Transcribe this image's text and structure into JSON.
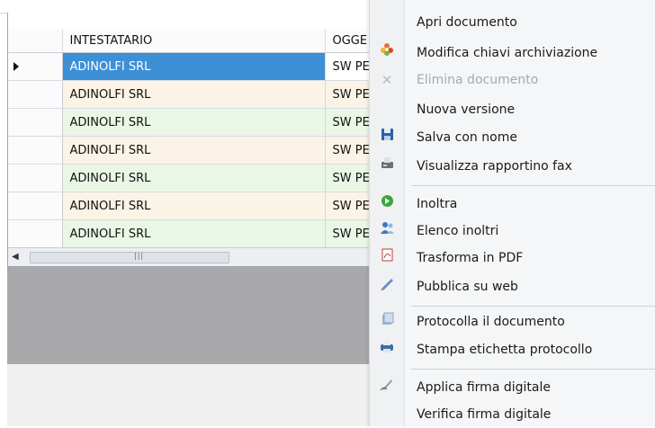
{
  "grid": {
    "columns": [
      "INTESTATARIO",
      "OGGE"
    ],
    "rows": [
      {
        "intestatario": "ADINOLFI SRL",
        "oggetto": "SW PE",
        "selected": true
      },
      {
        "intestatario": "ADINOLFI SRL",
        "oggetto": "SW PE"
      },
      {
        "intestatario": "ADINOLFI SRL",
        "oggetto": "SW PE"
      },
      {
        "intestatario": "ADINOLFI SRL",
        "oggetto": "SW PE"
      },
      {
        "intestatario": "ADINOLFI SRL",
        "oggetto": "SW PE"
      },
      {
        "intestatario": "ADINOLFI SRL",
        "oggetto": "SW PE"
      },
      {
        "intestatario": "ADINOLFI SRL",
        "oggetto": "SW PE"
      }
    ]
  },
  "context_menu": {
    "items": [
      {
        "label": "Apri documento",
        "icon": "none"
      },
      {
        "label": "Modifica chiavi archiviazione",
        "icon": "flower-icon"
      },
      {
        "label": "Elimina documento",
        "icon": "close-icon",
        "disabled": true
      },
      {
        "label": "Nuova versione",
        "icon": "none"
      },
      {
        "label": "Salva con nome",
        "icon": "floppy-icon"
      },
      {
        "label": "Visualizza rapportino fax",
        "icon": "fax-icon"
      },
      {
        "label": "Inoltra",
        "icon": "forward-icon"
      },
      {
        "label": "Elenco inoltri",
        "icon": "users-icon"
      },
      {
        "label": "Trasforma in PDF",
        "icon": "pdf-icon"
      },
      {
        "label": "Pubblica su web",
        "icon": "web-icon"
      },
      {
        "label": "Protocolla il documento",
        "icon": "document-icon"
      },
      {
        "label": "Stampa etichetta protocollo",
        "icon": "printer-icon"
      },
      {
        "label": "Applica firma digitale",
        "icon": "signature-icon"
      },
      {
        "label": "Verifica firma digitale",
        "icon": "none"
      }
    ]
  },
  "colors": {
    "selected_row": "#3d8fd6",
    "row_cream": "#fbf3e6",
    "row_green": "#eaf7e7",
    "gray_panel": "#a9a9ab"
  }
}
